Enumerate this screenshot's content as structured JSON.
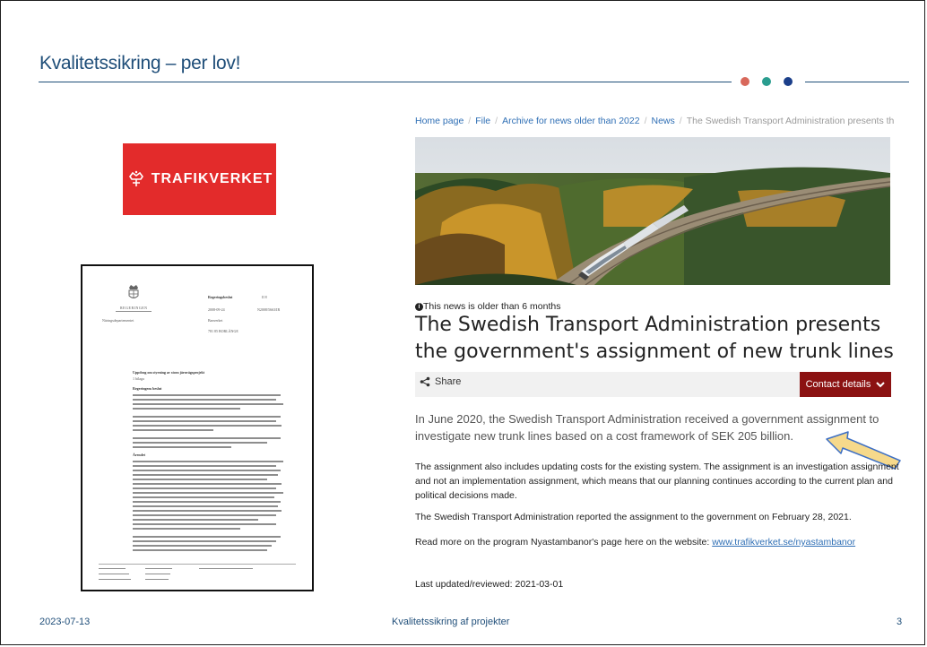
{
  "slide": {
    "title": "Kvalitetssikring – per lov!",
    "dots": [
      "#d8685b",
      "#2a9d8f",
      "#1b3f8a"
    ]
  },
  "logo": {
    "text": "TRAFIKVERKET",
    "color": "#e32b2b",
    "icon": "crown-icon"
  },
  "document": {
    "header": {
      "left_brand": "REGERINGEN",
      "ministry": "Näringsdepartementet",
      "decision_label": "Regeringsbeslut",
      "decision_no": "II 8",
      "date": "2008-09-24",
      "ref": "N2008/5663/IR",
      "recipient": "Banverket",
      "address": "781 85 BORLÄNGE"
    },
    "subject": "Uppdrag om styrning av stora järnvägsprojekt",
    "attachment": "1 bilaga",
    "heading_decision": "Regeringens beslut",
    "heading_matter": "Ärendet"
  },
  "web": {
    "breadcrumb": [
      "Home page",
      "File",
      "Archive for news older than 2022",
      "News",
      "The Swedish Transport Administration presents th"
    ],
    "notice": "This news is older than 6 months",
    "headline": "The Swedish Transport Administration presents the government's assignment of new trunk lines",
    "share_label": "Share",
    "contact_label": "Contact details",
    "lead": "In June 2020, the Swedish Transport Administration received a government assignment to investigate new trunk lines based on a cost framework of SEK 205 billion.",
    "para1": "The assignment also includes updating costs for the existing system. The assignment is an investigation assignment and not an implementation assignment, which means that our planning continues according to the current plan and political decisions made.",
    "para2": "The Swedish Transport Administration reported the assignment to the government on February 28, 2021.",
    "para3_prefix": "Read more on the program Nyastambanor's page here on the website: ",
    "para3_link": "www.trafikverket.se/nyastambanor",
    "updated": "Last updated/reviewed: 2021-03-01"
  },
  "footer": {
    "date": "2023-07-13",
    "center": "Kvalitetssikring af projekter",
    "page": "3"
  },
  "colors": {
    "brand_blue": "#1f4e79",
    "link": "#2f6fb5",
    "contact_bg": "#8b1212",
    "arrow_fill": "#f6d98b"
  }
}
